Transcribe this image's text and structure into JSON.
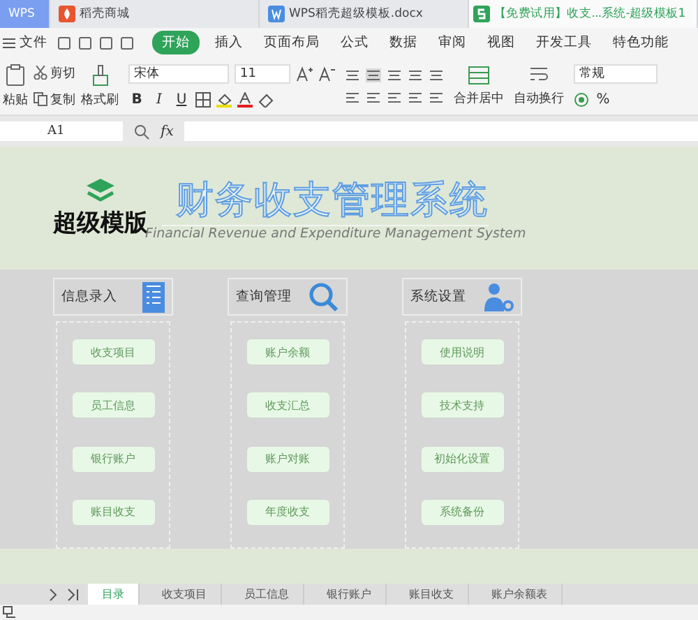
{
  "window_tabs": [
    {
      "label": "WPS",
      "kind": "home",
      "selected": false
    },
    {
      "label": "稻壳商城",
      "kind": "store",
      "selected": false
    },
    {
      "label": "WPS稻壳超级模板.docx",
      "kind": "doc",
      "selected": false
    },
    {
      "label": "【免费试用】收支...系统-超级模板1",
      "kind": "sheet",
      "selected": true
    }
  ],
  "menu": {
    "file": "文件",
    "tabs": [
      {
        "label": "开始",
        "selected": true
      },
      {
        "label": "插入",
        "selected": false
      },
      {
        "label": "页面布局",
        "selected": false
      },
      {
        "label": "公式",
        "selected": false
      },
      {
        "label": "数据",
        "selected": false
      },
      {
        "label": "审阅",
        "selected": false
      },
      {
        "label": "视图",
        "selected": false
      },
      {
        "label": "开发工具",
        "selected": false
      },
      {
        "label": "特色功能",
        "selected": false
      }
    ]
  },
  "toolbar": {
    "paste": "粘贴",
    "cut": "剪切",
    "copy": "复制",
    "format_painter": "格式刷",
    "font": "宋体",
    "font_size": "11",
    "bold": "B",
    "italic": "I",
    "underline": "U",
    "merge": "合并居中",
    "wrap": "自动换行",
    "number_format": "常规",
    "percent": "%"
  },
  "formula_bar": {
    "cell": "A1",
    "fx": "fx"
  },
  "banner": {
    "logo": "超级模版",
    "title": "财务收支管理系统",
    "subtitle": "Financial Revenue and Expenditure Management System"
  },
  "panels": [
    {
      "title": "信息录入",
      "buttons": [
        "收支项目",
        "员工信息",
        "银行账户",
        "账目收支"
      ]
    },
    {
      "title": "查询管理",
      "buttons": [
        "账户余额",
        "收支汇总",
        "账户对账",
        "年度收支"
      ]
    },
    {
      "title": "系统设置",
      "buttons": [
        "使用说明",
        "技术支持",
        "初始化设置",
        "系统备份"
      ]
    }
  ],
  "sheet_tabs": [
    {
      "label": "目录",
      "selected": true
    },
    {
      "label": "收支项目",
      "selected": false
    },
    {
      "label": "员工信息",
      "selected": false
    },
    {
      "label": "银行账户",
      "selected": false
    },
    {
      "label": "账目收支",
      "selected": false
    },
    {
      "label": "账户余额表",
      "selected": false
    }
  ]
}
